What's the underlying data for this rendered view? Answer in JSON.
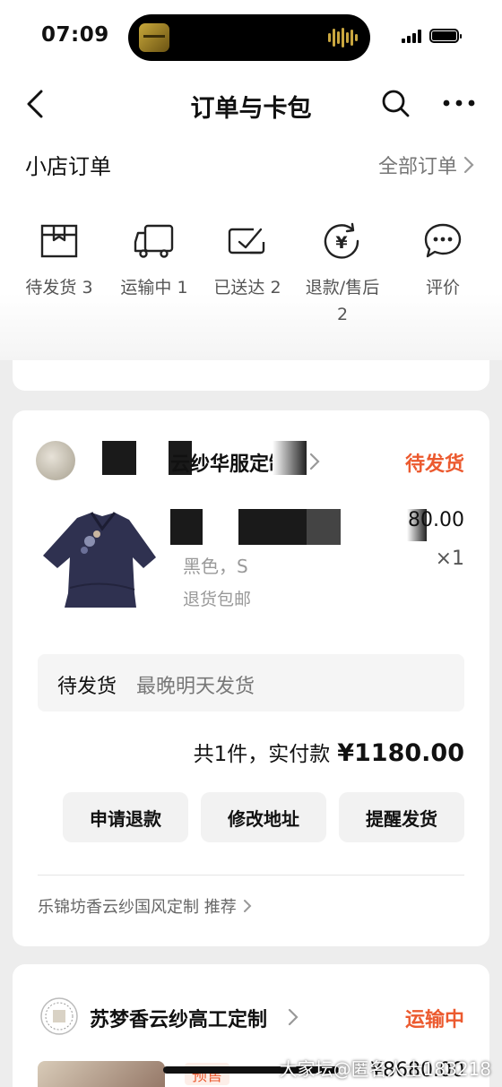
{
  "status_bar": {
    "time": "07:09"
  },
  "nav": {
    "title": "订单与卡包"
  },
  "shop_orders": {
    "title": "小店订单",
    "all_orders": "全部订单",
    "statuses": [
      {
        "label": "待发货 3",
        "icon": "box-icon"
      },
      {
        "label": "运输中 1",
        "icon": "truck-icon"
      },
      {
        "label": "已送达 2",
        "icon": "delivered-icon"
      },
      {
        "label": "退款/售后\n2",
        "icon": "refund-icon"
      },
      {
        "label": "评价",
        "icon": "comment-icon"
      }
    ]
  },
  "order1": {
    "shop_name": "云纱华服定制",
    "status": "待发货",
    "price": "80.00",
    "qty": "×1",
    "spec": "黑色，S",
    "tag": "退货包邮",
    "ship_status": "待发货",
    "ship_note": "最晚明天发货",
    "total_prefix": "共1件，实付款",
    "total_amount": "¥1180.00",
    "actions": {
      "refund": "申请退款",
      "address": "修改地址",
      "remind": "提醒发货"
    },
    "recommend": "乐锦坊香云纱国风定制 推荐"
  },
  "order2": {
    "shop_name": "苏梦香云纱高工定制",
    "status": "运输中",
    "tag": "预售",
    "price": "¥8680.00"
  },
  "watermark": "大家坛@匿名人士183218",
  "colors": {
    "accent": "#ec5a2f",
    "card_bg": "#ffffff",
    "page_bg": "#ededed"
  }
}
